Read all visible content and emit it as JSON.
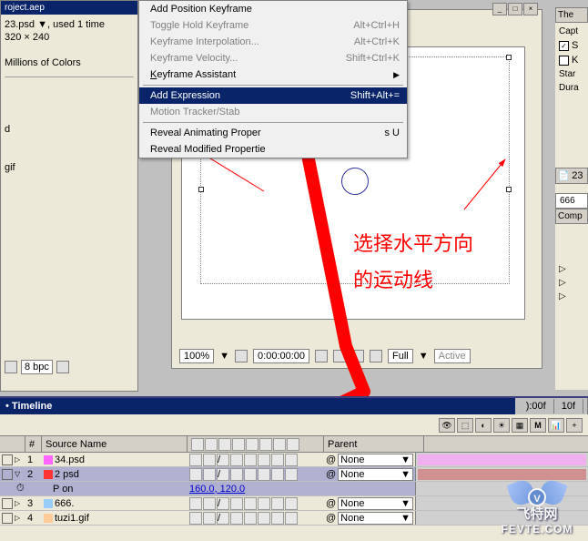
{
  "project": {
    "title": "roject.aep",
    "psd_line": "23.psd ▼, used 1 time",
    "dims": "320 × 240",
    "colors": "Millions of Colors",
    "item_d": "d",
    "item_gif": "gif",
    "bpc_label": "8 bpc"
  },
  "menu": {
    "add_position_kf": "Add Position Keyframe",
    "toggle_hold": "Toggle Hold Keyframe",
    "toggle_hold_sc": "Alt+Ctrl+H",
    "kf_interp": "Keyframe Interpolation...",
    "kf_interp_sc": "Alt+Ctrl+K",
    "kf_velocity": "Keyframe Velocity...",
    "kf_velocity_sc": "Shift+Ctrl+K",
    "kf_assistant": "Keyframe Assistant",
    "add_expression": "Add Expression",
    "add_expression_sc": "Shift+Alt+=",
    "motion_tracker": "Motion Tracker/Stab",
    "reveal_anim": "Reveal Animating Proper",
    "reveal_anim_sc": "s   U",
    "reveal_mod": "Reveal Modified Propertie"
  },
  "comp": {
    "zoom": "100%",
    "timecode": "0:00:00:00",
    "res": "Full",
    "active": "Active"
  },
  "right": {
    "tab_the": "The",
    "capt": "Capt",
    "s_label": "S",
    "k_label": "K",
    "star": "Star",
    "dura": "Dura",
    "num666": "666",
    "comp_label": "Comp",
    "item23": "23"
  },
  "annotation": {
    "line1": "选择水平方向",
    "line2": "的运动线"
  },
  "timeline": {
    "title": "Timeline",
    "col_num": "#",
    "col_source": "Source Name",
    "col_parent": "Parent",
    "frame_00": "):00f",
    "frame_10": "10f",
    "m_label": "M",
    "layers": [
      {
        "n": "1",
        "name": "34.psd",
        "color": "#ff66ff",
        "parent": "None",
        "sel": false
      },
      {
        "n": "2",
        "name": "2  psd",
        "color": "#ff3333",
        "parent": "None",
        "sel": true
      },
      {
        "n": "",
        "name": "P     on",
        "color": "",
        "parent": "",
        "sel": true,
        "pos": "160.0, 120.0"
      },
      {
        "n": "3",
        "name": "666.",
        "color": "#99ccff",
        "parent": "None",
        "sel": false
      },
      {
        "n": "4",
        "name": "tuzi1.gif",
        "color": "#ffcc99",
        "parent": "None",
        "sel": false
      }
    ]
  },
  "watermark": {
    "text": "飞特网",
    "url": "FEVTE.COM",
    "v": "V"
  }
}
